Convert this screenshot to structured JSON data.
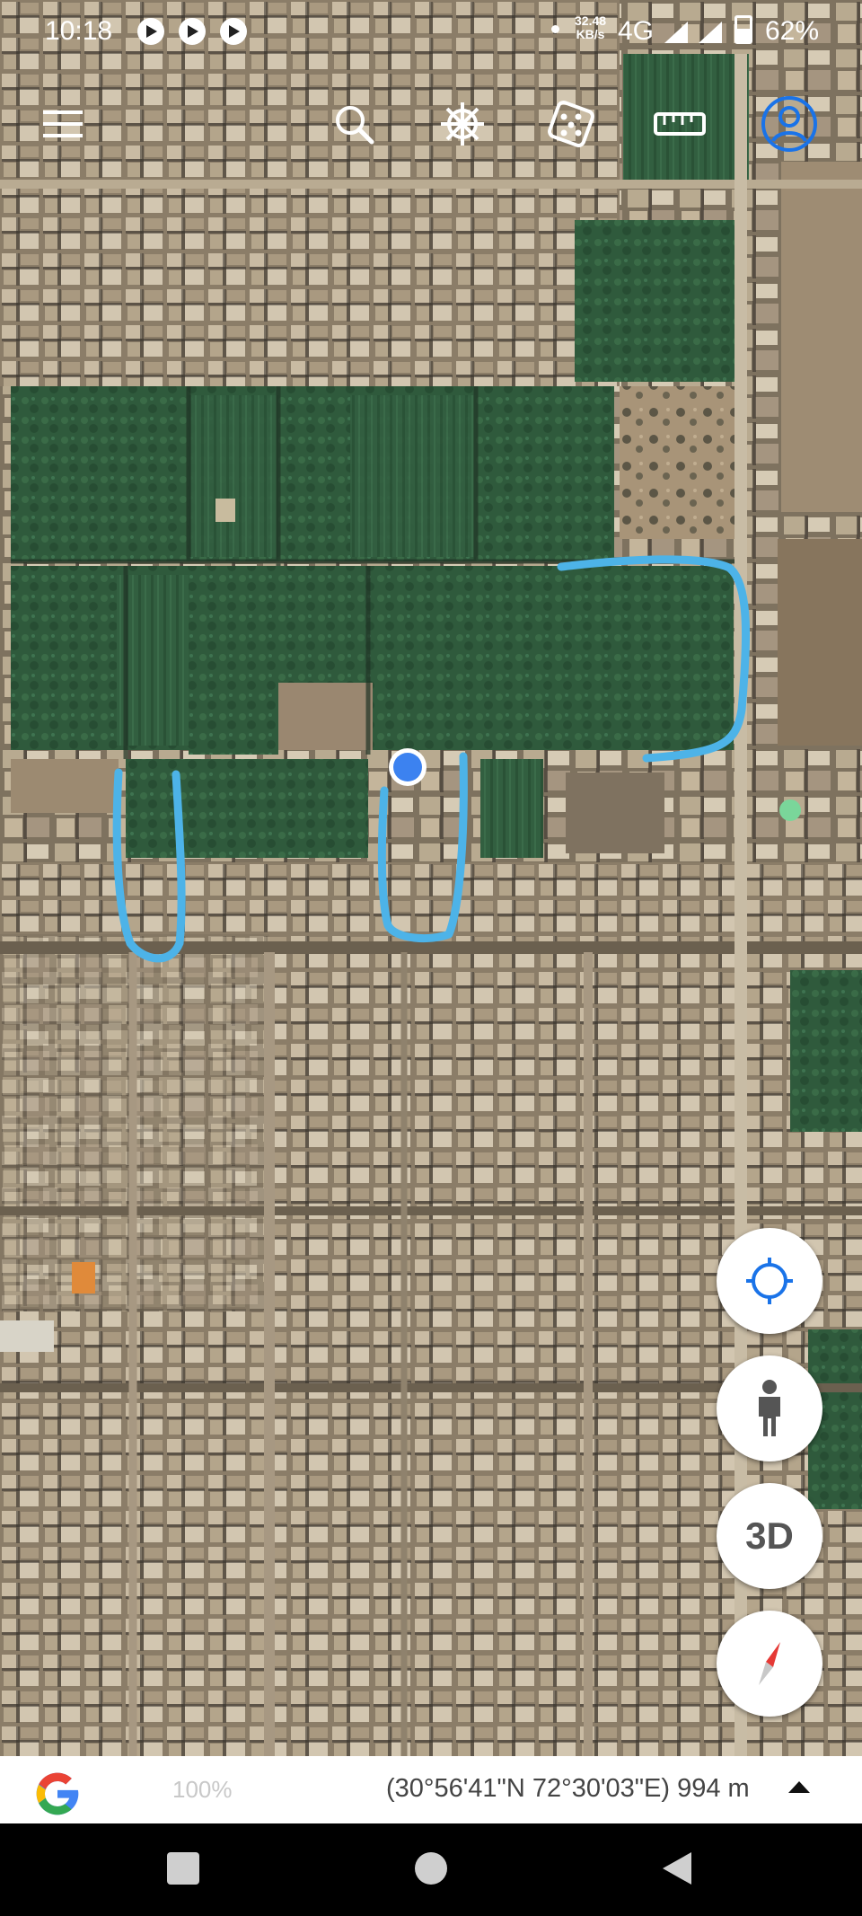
{
  "status_bar": {
    "time": "10:18",
    "net_speed_value": "32.48",
    "net_speed_unit": "KB/s",
    "network": "4G",
    "battery": "62%",
    "notification_icons": [
      "play-icon",
      "play-icon",
      "play-icon"
    ]
  },
  "toolbar": {
    "icons": [
      "menu-icon",
      "search-icon",
      "voyager-wheel-icon",
      "dice-icon",
      "ruler-icon",
      "account-icon"
    ]
  },
  "map": {
    "type": "satellite",
    "location_marker_color": "#3c82f0",
    "drawn_path_color": "#4db3e8"
  },
  "controls": {
    "three_d_label": "3D",
    "icons": [
      "my-location-icon",
      "pegman-icon",
      "compass-icon"
    ]
  },
  "info_bar": {
    "brand": "G",
    "zoom": "100%",
    "coordinates": "(30°56'41\"N 72°30'03\"E) 994 m"
  },
  "nav_bar": {
    "icons": [
      "recents-icon",
      "home-icon",
      "back-icon"
    ]
  },
  "colors": {
    "accent_blue": "#1a73e8",
    "field_green": "#2f5a3c",
    "roof_tan": "#b8a88e"
  }
}
